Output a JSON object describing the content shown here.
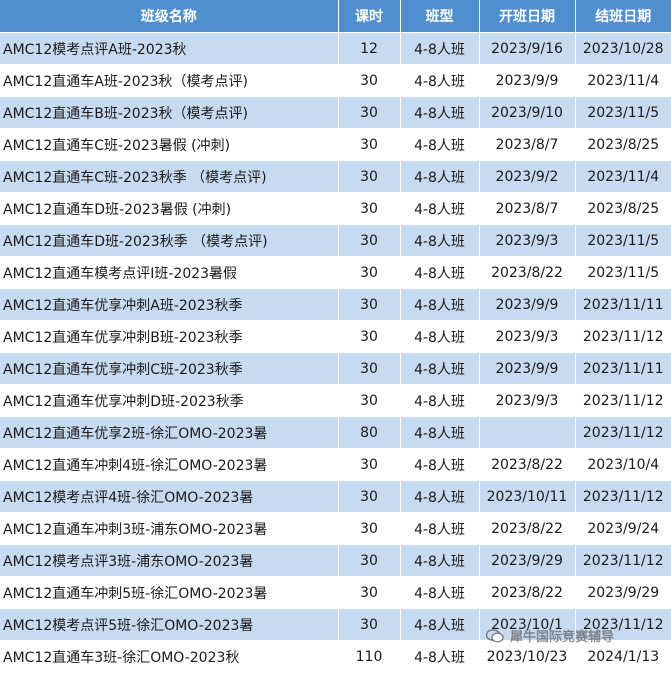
{
  "headers": {
    "name": "班级名称",
    "hours": "课时",
    "class_size": "班型",
    "start": "开班日期",
    "end": "结班日期"
  },
  "rows": [
    {
      "name": "AMC12模考点评A班-2023秋",
      "hours": "12",
      "class_size": "4-8人班",
      "start": "2023/9/16",
      "end": "2023/10/28"
    },
    {
      "name": "AMC12直通车A班-2023秋（模考点评)",
      "hours": "30",
      "class_size": "4-8人班",
      "start": "2023/9/9",
      "end": "2023/11/4"
    },
    {
      "name": "AMC12直通车B班-2023秋（模考点评)",
      "hours": "30",
      "class_size": "4-8人班",
      "start": "2023/9/10",
      "end": "2023/11/5"
    },
    {
      "name": "AMC12直通车C班-2023暑假 (冲刺)",
      "hours": "30",
      "class_size": "4-8人班",
      "start": "2023/8/7",
      "end": "2023/8/25"
    },
    {
      "name": "AMC12直通车C班-2023秋季 （模考点评)",
      "hours": "30",
      "class_size": "4-8人班",
      "start": "2023/9/2",
      "end": "2023/11/4"
    },
    {
      "name": "AMC12直通车D班-2023暑假 (冲刺)",
      "hours": "30",
      "class_size": "4-8人班",
      "start": "2023/8/7",
      "end": "2023/8/25"
    },
    {
      "name": "AMC12直通车D班-2023秋季 （模考点评)",
      "hours": "30",
      "class_size": "4-8人班",
      "start": "2023/9/3",
      "end": "2023/11/5"
    },
    {
      "name": "AMC12直通车模考点评I班-2023暑假",
      "hours": "30",
      "class_size": "4-8人班",
      "start": "2023/8/22",
      "end": "2023/11/5"
    },
    {
      "name": "AMC12直通车优享冲刺A班-2023秋季",
      "hours": "30",
      "class_size": "4-8人班",
      "start": "2023/9/9",
      "end": "2023/11/11"
    },
    {
      "name": "AMC12直通车优享冲刺B班-2023秋季",
      "hours": "30",
      "class_size": "4-8人班",
      "start": "2023/9/3",
      "end": "2023/11/12"
    },
    {
      "name": "AMC12直通车优享冲刺C班-2023秋季",
      "hours": "30",
      "class_size": "4-8人班",
      "start": "2023/9/9",
      "end": "2023/11/11"
    },
    {
      "name": "AMC12直通车优享冲刺D班-2023秋季",
      "hours": "30",
      "class_size": "4-8人班",
      "start": "2023/9/3",
      "end": "2023/11/12"
    },
    {
      "name": "AMC12直通车优享2班-徐汇OMO-2023暑",
      "hours": "80",
      "class_size": "4-8人班",
      "start": "",
      "end": "2023/11/12"
    },
    {
      "name": "AMC12直通车冲刺4班-徐汇OMO-2023暑",
      "hours": "30",
      "class_size": "4-8人班",
      "start": "2023/8/22",
      "end": "2023/10/4"
    },
    {
      "name": "AMC12模考点评4班-徐汇OMO-2023暑",
      "hours": "30",
      "class_size": "4-8人班",
      "start": "2023/10/11",
      "end": "2023/11/12"
    },
    {
      "name": "AMC12直通车冲刺3班-浦东OMO-2023暑",
      "hours": "30",
      "class_size": "4-8人班",
      "start": "2023/8/22",
      "end": "2023/9/24"
    },
    {
      "name": "AMC12模考点评3班-浦东OMO-2023暑",
      "hours": "30",
      "class_size": "4-8人班",
      "start": "2023/9/29",
      "end": "2023/11/12"
    },
    {
      "name": "AMC12直通车冲刺5班-徐汇OMO-2023暑",
      "hours": "30",
      "class_size": "4-8人班",
      "start": "2023/8/22",
      "end": "2023/9/29"
    },
    {
      "name": "AMC12模考点评5班-徐汇OMO-2023暑",
      "hours": "30",
      "class_size": "4-8人班",
      "start": "2023/10/1",
      "end": "2023/11/12"
    },
    {
      "name": "AMC12直通车3班-徐汇OMO-2023秋",
      "hours": "110",
      "class_size": "4-8人班",
      "start": "2023/10/23",
      "end": "2024/1/13"
    }
  ],
  "watermark": {
    "text": "犀牛国际竞赛辅导",
    "icon": "wechat-icon"
  },
  "colors": {
    "header_bg": "#4f8fd0",
    "stripe_bg": "#c8daf0",
    "header_text": "#ffffff"
  }
}
